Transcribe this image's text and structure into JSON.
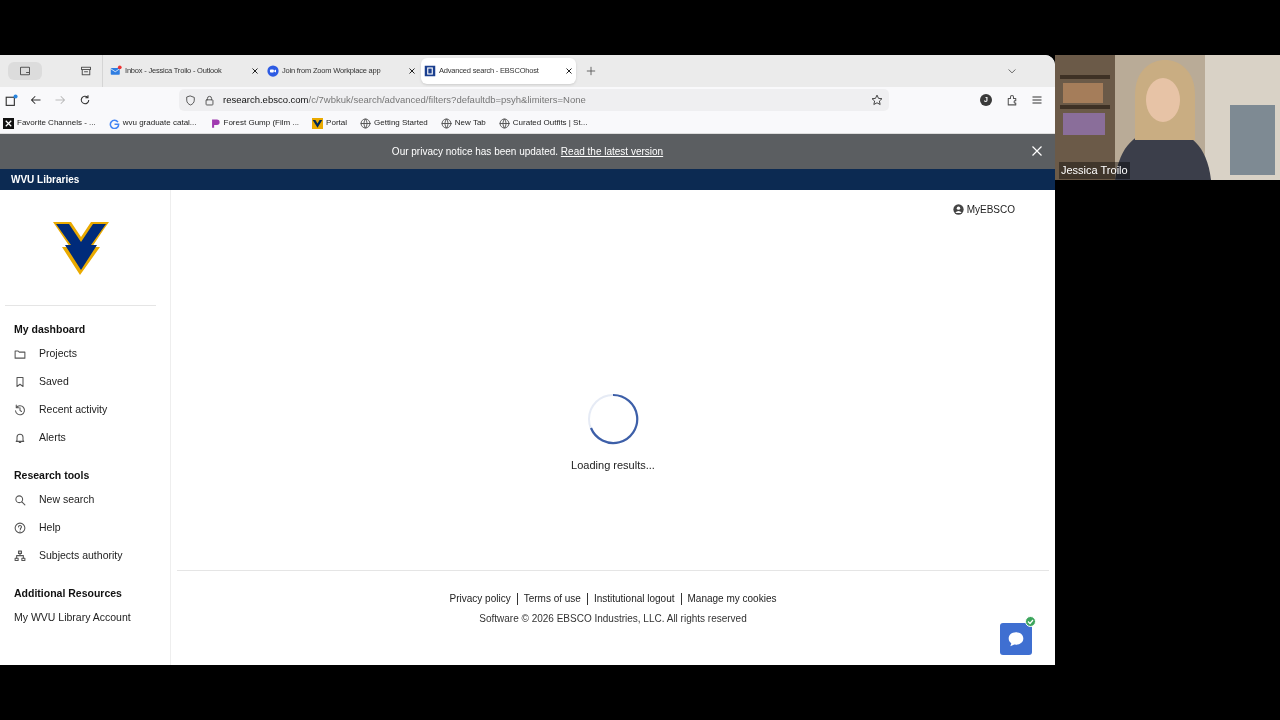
{
  "browser": {
    "tabs": [
      {
        "title": "Inbox - Jessica Troilo - Outlook",
        "selected": false
      },
      {
        "title": "Join from Zoom Workplace app",
        "selected": false
      },
      {
        "title": "Advanced search - EBSCOhost",
        "selected": true
      }
    ],
    "url_host": "research.ebsco.com",
    "url_path": "/c/7wbkuk/search/advanced/filters?defaultdb=psyh&limiters=None",
    "profile_initial": "J",
    "bookmarks": [
      "Favorite Channels - ...",
      "wvu graduate catal...",
      "Forest Gump (Film ...",
      "Portal",
      "Getting Started",
      "New Tab",
      "Curated Outfits | St..."
    ]
  },
  "banner": {
    "text": "Our privacy notice has been updated.",
    "link": "Read the latest version"
  },
  "site_header": "WVU Libraries",
  "sidebar": {
    "sections": [
      {
        "title": "My dashboard",
        "items": [
          "Projects",
          "Saved",
          "Recent activity",
          "Alerts"
        ]
      },
      {
        "title": "Research tools",
        "items": [
          "New search",
          "Help",
          "Subjects authority"
        ]
      },
      {
        "title": "Additional Resources",
        "items": [
          "My WVU Library Account"
        ]
      }
    ]
  },
  "account_link": "MyEBSCO",
  "loading_text": "Loading results...",
  "footer": {
    "links": [
      "Privacy policy",
      "Terms of use",
      "Institutional logout",
      "Manage my cookies"
    ],
    "copyright": "Software © 2026 EBSCO Industries, LLC. All rights reserved"
  },
  "chat": {
    "online": true
  },
  "participant": {
    "name": "Jessica Troilo"
  }
}
